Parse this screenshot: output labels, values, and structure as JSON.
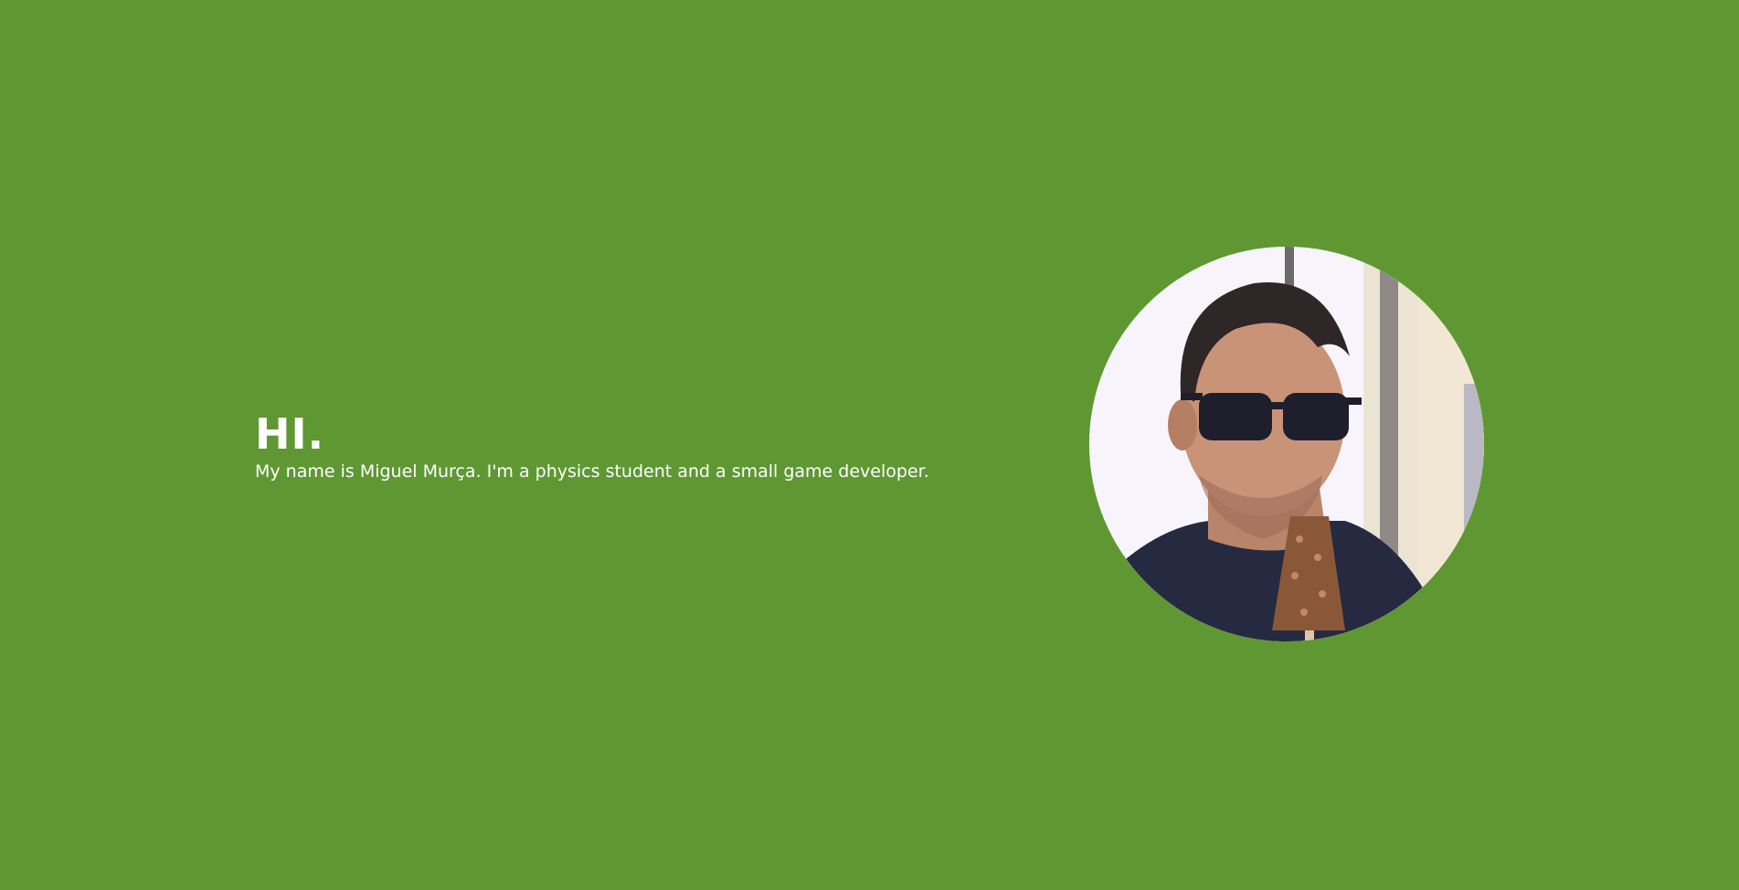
{
  "hero": {
    "title": "HI.",
    "subtitle": "My name is Miguel Murça. I'm a physics student and a small game developer."
  },
  "avatar": {
    "description_icon": "profile-photo",
    "background_color": "#5f9833"
  }
}
